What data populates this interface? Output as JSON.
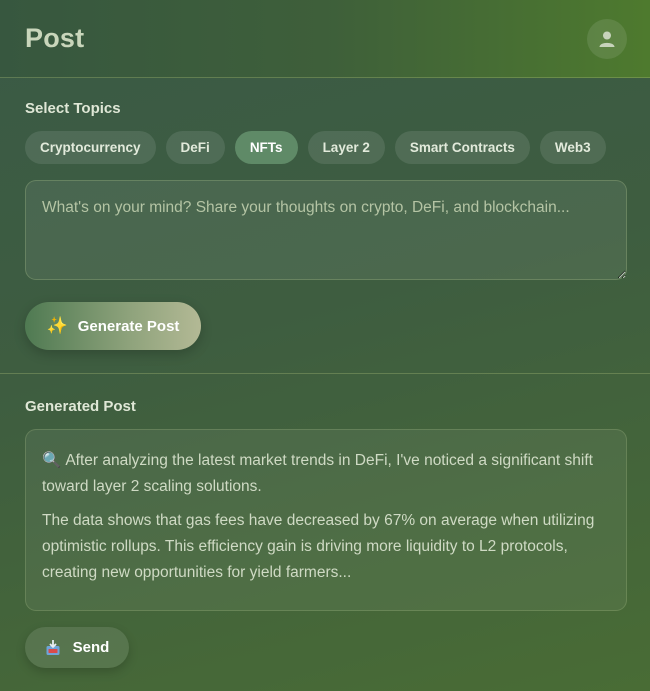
{
  "header": {
    "title": "Post",
    "avatar_icon": "user-icon"
  },
  "topics": {
    "label": "Select Topics",
    "chips": [
      {
        "label": "Cryptocurrency",
        "active": false
      },
      {
        "label": "DeFi",
        "active": false
      },
      {
        "label": "NFTs",
        "active": true
      },
      {
        "label": "Layer 2",
        "active": false
      },
      {
        "label": "Smart Contracts",
        "active": false
      },
      {
        "label": "Web3",
        "active": false
      }
    ]
  },
  "composer": {
    "placeholder": "What's on your mind? Share your thoughts on crypto, DeFi, and blockchain...",
    "value": "",
    "generate_icon": "✨",
    "generate_label": "Generate Post"
  },
  "output": {
    "label": "Generated Post",
    "icon": "🔍",
    "paragraph1": "After analyzing the latest market trends in DeFi, I've noticed a significant shift toward layer 2 scaling solutions.",
    "paragraph2": "The data shows that gas fees have decreased by 67% on average when utilizing optimistic rollups. This efficiency gain is driving more liquidity to L2 protocols, creating new opportunities for yield farmers...",
    "send_icon": "inbox-tray-icon",
    "send_label": "Send"
  },
  "colors": {
    "accent": "#5f8a67",
    "background": "#3f5c40",
    "title": "#c9d6bb"
  }
}
